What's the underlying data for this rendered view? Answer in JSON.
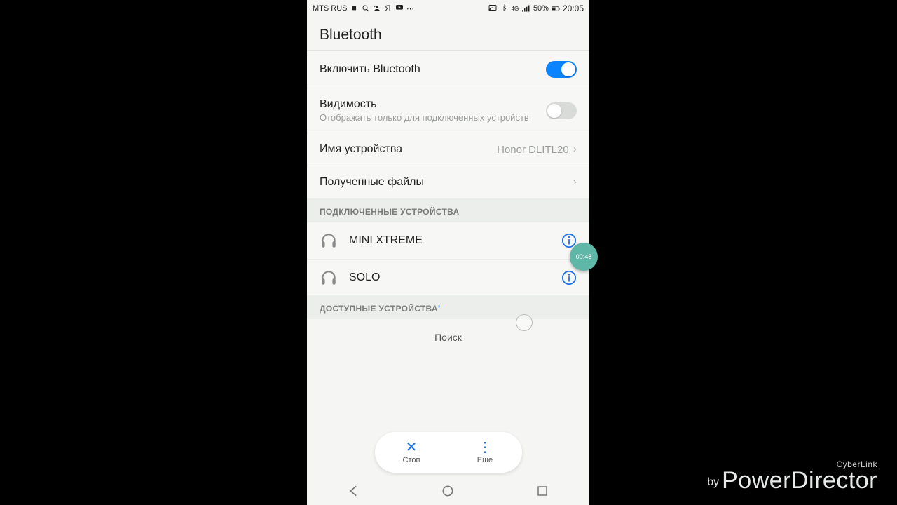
{
  "statusbar": {
    "carrier": "MTS RUS",
    "battery": "50%",
    "time": "20:05"
  },
  "screen": {
    "title": "Bluetooth",
    "toggle_bt_label": "Включить Bluetooth",
    "visibility_label": "Видимость",
    "visibility_sub": "Отображать только для подключенных устройств",
    "device_name_label": "Имя устройства",
    "device_name_value": "Honor DLITL20",
    "received_files_label": "Полученные файлы",
    "connected_header": "ПОДКЛЮЧЕННЫЕ УСТРОЙСТВА",
    "available_header": "ДОСТУПНЫЕ УСТРОЙСТВА",
    "searching_label": "Поиск",
    "devices": [
      {
        "name": "MINI XTREME"
      },
      {
        "name": "SOLO"
      }
    ]
  },
  "actions": {
    "stop": "Стоп",
    "more": "Еще"
  },
  "recording_timer": "00:48",
  "watermark": {
    "top": "CyberLink",
    "by": "by",
    "main": "PowerDirector"
  }
}
